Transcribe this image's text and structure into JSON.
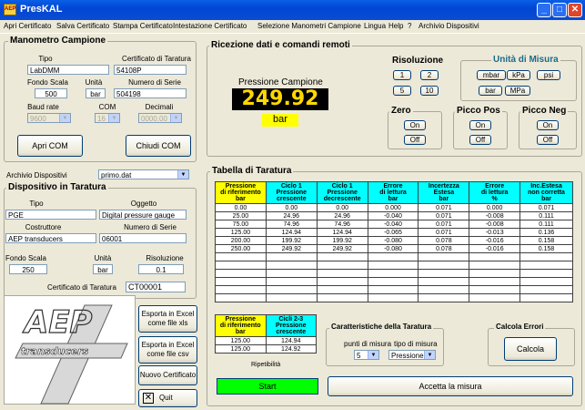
{
  "window": {
    "title": "PresKAL",
    "icon": "aep-app-icon"
  },
  "menu": [
    "Apri Certificato",
    "Salva Certificato",
    "Stampa Certificato",
    "Intestazione Certificato",
    "Selezione Manometri Campione",
    "Lingua",
    "Help",
    "?",
    "Archivio Dispositivi"
  ],
  "manometro": {
    "title": "Manometro Campione",
    "tipo_label": "Tipo",
    "tipo": "LabDMM",
    "cert_label": "Certificato di Taratura",
    "cert": "54108P",
    "fondo_label": "Fondo Scala",
    "fondo": "500",
    "unita_label": "Unità",
    "unita": "bar",
    "serie_label": "Numero di Serie",
    "serie": "504198",
    "baud_label": "Baud rate",
    "baud": "9600",
    "com_label": "COM",
    "com": "16",
    "dec_label": "Decimali",
    "dec": "0000.00",
    "apri_com": "Apri COM",
    "chiudi_com": "Chiudi COM"
  },
  "archivio": {
    "label": "Archivio Dispositivi",
    "value": "primo.dat"
  },
  "dispositivo": {
    "title": "Dispositivo in Taratura",
    "tipo_label": "Tipo",
    "tipo": "PGE",
    "oggetto_label": "Oggetto",
    "oggetto": "Digital pressure gauge",
    "costr_label": "Costruttore",
    "costr": "AEP transducers",
    "serie_label": "Numero di Serie",
    "serie": "06001",
    "fondo_label": "Fondo Scala",
    "fondo": "250",
    "unita_label": "Unità",
    "unita": "bar",
    "ris_label": "Risoluzione",
    "ris": "0.1",
    "cert_label": "Certificato di Taratura",
    "cert": "CT00001"
  },
  "ricezione": {
    "title": "Ricezione dati e comandi remoti",
    "pressione_label": "Pressione Campione",
    "pressione": "249.92",
    "unit": "bar",
    "ris_title": "Risoluzione",
    "ris_btns": [
      "1",
      "2",
      "5",
      "10"
    ],
    "um_title": "Unità di Misura",
    "um_btns": [
      "mbar",
      "kPa",
      "psi",
      "bar",
      "MPa"
    ],
    "zero_title": "Zero",
    "pos_title": "Picco Pos",
    "neg_title": "Picco Neg",
    "on": "On",
    "off": "Off"
  },
  "tabella": {
    "title": "Tabella di Taratura",
    "headers": [
      [
        "Pressione",
        "di riferimento",
        "bar"
      ],
      [
        "Ciclo 1",
        "Pressione",
        "crescente"
      ],
      [
        "Ciclo 1",
        "Pressione",
        "decrescente"
      ],
      [
        "Errore",
        "di lettura",
        "bar"
      ],
      [
        "Incertezza",
        "Estesa",
        "bar"
      ],
      [
        "Errore",
        "di lettura",
        "%"
      ],
      [
        "Inc.Estesa",
        "non corretta",
        "bar"
      ]
    ],
    "rows": [
      [
        "0.00",
        "0.00",
        "0.00",
        "0.000",
        "0.071",
        "0.000",
        "0.071"
      ],
      [
        "25.00",
        "24.96",
        "24.96",
        "-0.040",
        "0.071",
        "-0.008",
        "0.111"
      ],
      [
        "75.00",
        "74.96",
        "74.96",
        "-0.040",
        "0.071",
        "-0.008",
        "0.111"
      ],
      [
        "125.00",
        "124.94",
        "124.94",
        "-0.065",
        "0.071",
        "-0.013",
        "0.136"
      ],
      [
        "200.00",
        "199.92",
        "199.92",
        "-0.080",
        "0.078",
        "-0.016",
        "0.158"
      ],
      [
        "250.00",
        "249.92",
        "249.92",
        "-0.080",
        "0.078",
        "-0.016",
        "0.158"
      ]
    ],
    "empty_rows": 6
  },
  "rip": {
    "headers": [
      [
        "Pressione",
        "di riferimento",
        "bar"
      ],
      [
        "Cicli 2-3",
        "Pressione",
        "crescente"
      ]
    ],
    "rows": [
      [
        "125.00",
        "124.94"
      ],
      [
        "125.00",
        "124.92"
      ]
    ],
    "label": "Ripetibilità"
  },
  "caratteristiche": {
    "title": "Caratteristiche della Taratura",
    "punti_label": "punti di misura",
    "punti": "5",
    "tipo_label": "tipo di misura",
    "tipo": "Pressione"
  },
  "calcola": {
    "title": "Calcola Errori",
    "btn": "Calcola"
  },
  "export": {
    "xls": "Esporta in Excel come file xls",
    "csv": "Esporta in Excel come file csv",
    "nuovo": "Nuovo Certificato",
    "quit": "Quit"
  },
  "start": "Start",
  "accetta": "Accetta la misura",
  "logo": {
    "text": "AEP",
    "sub": "transducers"
  }
}
